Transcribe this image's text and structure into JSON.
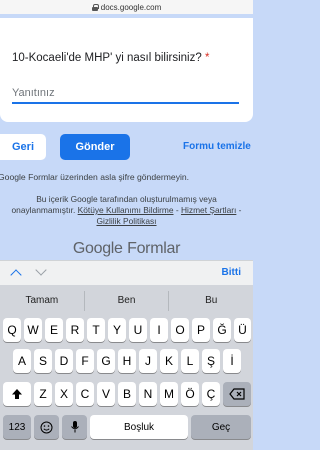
{
  "browser": {
    "url": "docs.google.com"
  },
  "form": {
    "question": "10-Kocaeli'de MHP' yi nasıl bilirsiniz?",
    "required_mark": "*",
    "answer_placeholder": "Yanıtınız",
    "back_label": "Geri",
    "submit_label": "Gönder",
    "clear_label": "Formu temizle"
  },
  "footer": {
    "never_submit_passwords": "Google Formlar üzerinden asla şifre göndermeyin.",
    "disclaimer_line1": "Bu içerik Google tarafından oluşturulmamış veya",
    "disclaimer_line2_prefix": "onaylanmamıştır.",
    "abuse_link": "Kötüye Kullanımı Bildirme",
    "sep1": " - ",
    "terms_link": "Hizmet Şartları",
    "sep2": " -",
    "privacy_link": "Gizlilik Politikası",
    "logo_google": "Google",
    "logo_forms": "Formlar"
  },
  "keyboard_toolbar": {
    "done_label": "Bitti"
  },
  "keyboard": {
    "suggestions": [
      "Tamam",
      "Ben",
      "Bu"
    ],
    "row1": [
      "Q",
      "W",
      "E",
      "R",
      "T",
      "Y",
      "U",
      "I",
      "O",
      "P",
      "Ğ",
      "Ü"
    ],
    "row2": [
      "A",
      "S",
      "D",
      "F",
      "G",
      "H",
      "J",
      "K",
      "L",
      "Ş",
      "İ"
    ],
    "row3": [
      "Z",
      "X",
      "C",
      "V",
      "B",
      "N",
      "M",
      "Ö",
      "Ç"
    ],
    "numbers_label": "123",
    "space_label": "Boşluk",
    "return_label": "Geç"
  }
}
